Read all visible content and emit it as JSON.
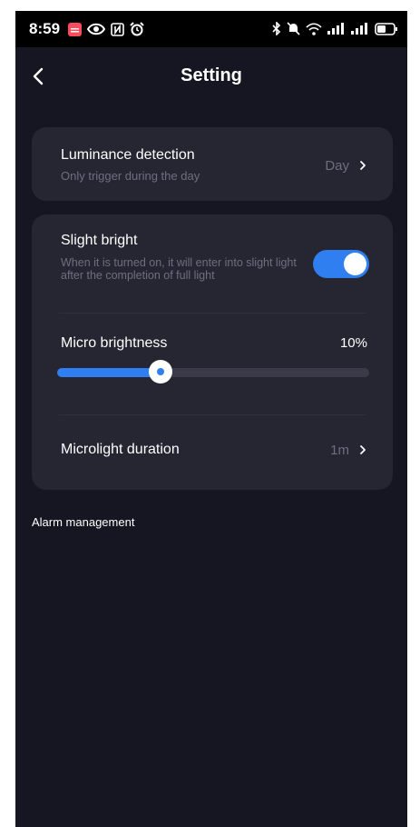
{
  "status_bar": {
    "time": "8:59",
    "icons_left": [
      "notification-app-icon",
      "eye-icon",
      "nfc-icon",
      "alarm-clock-icon"
    ],
    "icons_right": [
      "bluetooth-icon",
      "mute-icon",
      "wifi-icon",
      "signal-icon",
      "signal-icon",
      "battery-icon"
    ]
  },
  "header": {
    "back_icon": "chevron-left-icon",
    "title": "Setting"
  },
  "luminance": {
    "title": "Luminance detection",
    "subtitle": "Only trigger during the day",
    "value": "Day"
  },
  "slight_bright": {
    "title": "Slight bright",
    "description": "When it is turned on, it will enter into slight light after the completion of full light",
    "enabled": true
  },
  "micro_brightness": {
    "title": "Micro brightness",
    "value_text": "10%",
    "slider_fraction": 0.33
  },
  "microlight_duration": {
    "title": "Microlight duration",
    "value": "1m"
  },
  "alarm_section": {
    "label": "Alarm management"
  },
  "colors": {
    "background": "#161623",
    "card": "#262633",
    "accent": "#2f7ff0",
    "secondary_text": "#6e6e7e"
  }
}
